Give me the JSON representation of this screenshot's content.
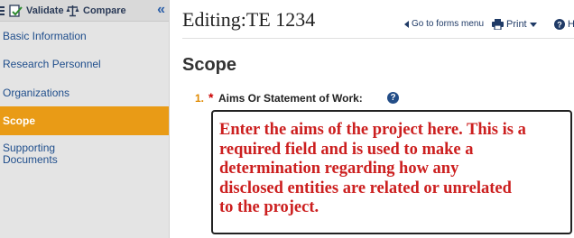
{
  "toolbar": {
    "validate_label": "Validate",
    "compare_label": "Compare",
    "collapse_glyph": "«"
  },
  "sidebar": {
    "items": [
      {
        "label": "Basic Information",
        "active": false
      },
      {
        "label": "Research Personnel",
        "active": false
      },
      {
        "label": "Organizations",
        "active": false
      },
      {
        "label": "Scope",
        "active": true
      },
      {
        "label": "Supporting\nDocuments",
        "active": false
      }
    ]
  },
  "header": {
    "title": "Editing:TE 1234",
    "go_to_forms_label": "Go to forms menu",
    "print_label": "Print",
    "help_label": "H"
  },
  "main": {
    "section_title": "Scope",
    "question": {
      "number": "1.",
      "required_marker": "*",
      "label": "Aims Or Statement of Work:",
      "help_glyph": "?",
      "answer": "Enter the aims of the project here. This is a\nrequired field and is used to make a\ndetermination regarding how any\ndisclosed entities are related or unrelated\nto the project."
    }
  },
  "colors": {
    "sidebar_bg": "#e4e4e4",
    "active_item": "#e99b16",
    "link_blue": "#1f4e8c",
    "answer_red": "#cc1f1f",
    "question_number": "#e08a00"
  }
}
